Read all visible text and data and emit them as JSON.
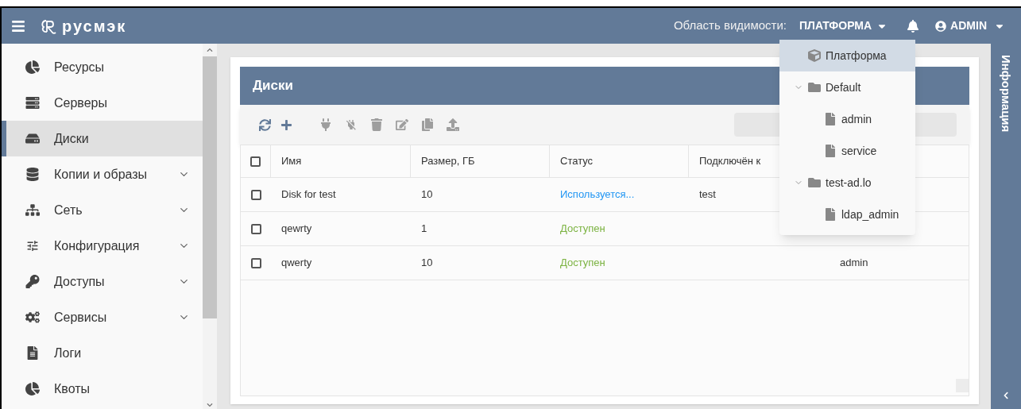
{
  "header": {
    "logo_text": "русмэк",
    "scope_label": "Область видимости:",
    "scope_value": "ПЛАТФОРМА",
    "user": "ADMIN"
  },
  "sidebar": {
    "items": [
      {
        "label": "Ресурсы",
        "selected": false,
        "expandable": false
      },
      {
        "label": "Серверы",
        "selected": false,
        "expandable": false
      },
      {
        "label": "Диски",
        "selected": true,
        "expandable": false
      },
      {
        "label": "Копии и образы",
        "selected": false,
        "expandable": true
      },
      {
        "label": "Сеть",
        "selected": false,
        "expandable": true
      },
      {
        "label": "Конфигурация",
        "selected": false,
        "expandable": true
      },
      {
        "label": "Доступы",
        "selected": false,
        "expandable": true
      },
      {
        "label": "Сервисы",
        "selected": false,
        "expandable": true
      },
      {
        "label": "Логи",
        "selected": false,
        "expandable": false
      },
      {
        "label": "Квоты",
        "selected": false,
        "expandable": false
      }
    ]
  },
  "panel": {
    "title": "Диски",
    "select_all_checked": false,
    "columns": [
      "Имя",
      "Размер, ГБ",
      "Статус",
      "Подключён к"
    ],
    "rows": [
      {
        "checked": false,
        "cells": [
          "Disk for test",
          "10",
          "Используется...",
          "test",
          ""
        ],
        "color": "#2196f3"
      },
      {
        "checked": false,
        "cells": [
          "qewrty",
          "1",
          "Доступен",
          "",
          ""
        ],
        "color": "#7cb342"
      },
      {
        "checked": false,
        "cells": [
          "qwerty",
          "10",
          "Доступен",
          "",
          "admin"
        ],
        "color": "#7cb342"
      }
    ]
  },
  "scope_menu": {
    "items": [
      {
        "label": "Платформа",
        "kind": "platform",
        "selected": true
      },
      {
        "label": "Default",
        "kind": "folder",
        "selected": false,
        "expanded": true,
        "children": [
          {
            "label": "admin",
            "kind": "file",
            "selected": false
          },
          {
            "label": "service",
            "kind": "file",
            "selected": false
          }
        ]
      },
      {
        "label": "test-ad.lo",
        "kind": "folder",
        "selected": false,
        "expanded": true,
        "children": [
          {
            "label": "ldap_admin",
            "kind": "file",
            "selected": false
          }
        ]
      }
    ]
  },
  "info_panel": {
    "title": "Информация"
  }
}
